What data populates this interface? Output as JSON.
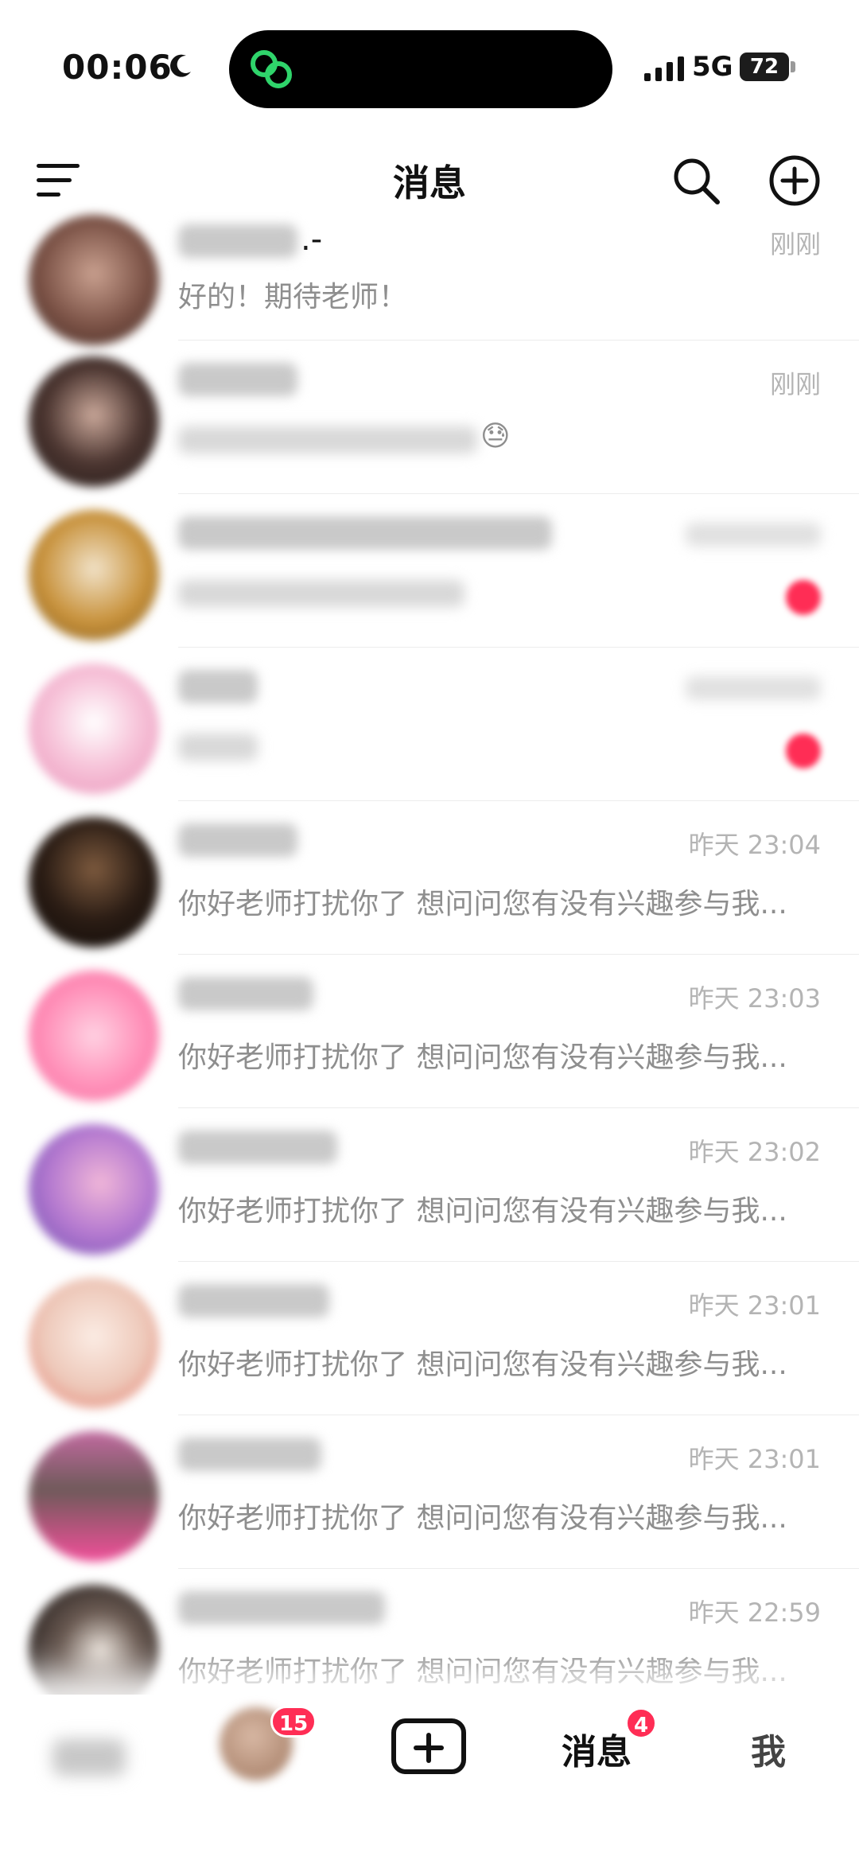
{
  "status_bar": {
    "time": "00:06",
    "network": "5G",
    "battery": "72",
    "icons": [
      "moon-icon",
      "app-activity-icon",
      "signal-icon",
      "battery-icon"
    ]
  },
  "header": {
    "title": "消息",
    "icons": [
      "menu-icon",
      "search-icon",
      "add-icon"
    ]
  },
  "conversations": [
    {
      "name_suffix": ".-",
      "time": "刚刚",
      "preview": "好的！期待老师！"
    },
    {
      "name_suffix": "",
      "time": "刚刚",
      "preview": "",
      "preview_emoji": "😓"
    },
    {
      "name_suffix": "",
      "time": "",
      "preview": "",
      "unread": true
    },
    {
      "name_suffix": "",
      "time": "",
      "preview": "",
      "unread": true
    },
    {
      "name_suffix": "",
      "time": "昨天 23:04",
      "preview": "你好老师打扰你了 想问问您有没有兴趣参与我..."
    },
    {
      "name_suffix": "",
      "time": "昨天 23:03",
      "preview": "你好老师打扰你了 想问问您有没有兴趣参与我..."
    },
    {
      "name_suffix": "",
      "time": "昨天 23:02",
      "preview": "你好老师打扰你了 想问问您有没有兴趣参与我..."
    },
    {
      "name_suffix": "",
      "time": "昨天 23:01",
      "preview": "你好老师打扰你了 想问问您有没有兴趣参与我..."
    },
    {
      "name_suffix": "",
      "time": "昨天 23:01",
      "preview": "你好老师打扰你了 想问问您有没有兴趣参与我..."
    },
    {
      "name_suffix": "",
      "time": "昨天 22:59",
      "preview": "你好老师打扰你了 想问问您有没有兴趣参与我..."
    }
  ],
  "tab_bar": {
    "friends_badge": "15",
    "messages_label": "消息",
    "messages_badge": "4",
    "me_label": "我"
  },
  "colors": {
    "badge": "#ff2d55",
    "timestamp": "#b4b4b4",
    "preview_text": "#8e8e8e"
  }
}
